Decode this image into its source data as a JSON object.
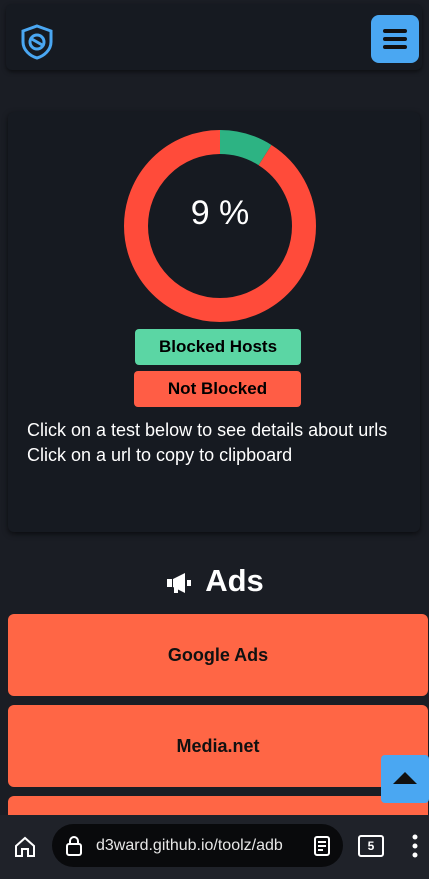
{
  "header": {
    "logo_icon": "shield-logo-icon",
    "menu_icon": "hamburger-menu-icon"
  },
  "summary": {
    "percent_label": "9 %",
    "legend_blocked": "Blocked Hosts",
    "legend_not_blocked": "Not Blocked",
    "info_line1": "Click on a test below to see details about urls",
    "info_line2": "Click on a url to copy to clipboard"
  },
  "chart_data": {
    "type": "pie",
    "categories": [
      "Blocked Hosts",
      "Not Blocked"
    ],
    "values": [
      9,
      91
    ],
    "colors": [
      "#2db383",
      "#ff4b3a"
    ]
  },
  "section": {
    "title": "Ads",
    "icon": "megaphone-icon"
  },
  "tests": [
    {
      "label": "Google Ads"
    },
    {
      "label": "Media.net"
    },
    {
      "label": ""
    }
  ],
  "browser": {
    "url": "d3ward.github.io/toolz/adb",
    "tab_count": "5",
    "home_icon": "home-icon",
    "lock_icon": "lock-icon",
    "reader_icon": "reader-mode-icon",
    "more_icon": "more-vertical-icon"
  },
  "colors": {
    "accent": "#4aa7f2",
    "blocked": "#5bd6a4",
    "not_blocked": "#ff5d45",
    "test_button": "#ff6645"
  }
}
